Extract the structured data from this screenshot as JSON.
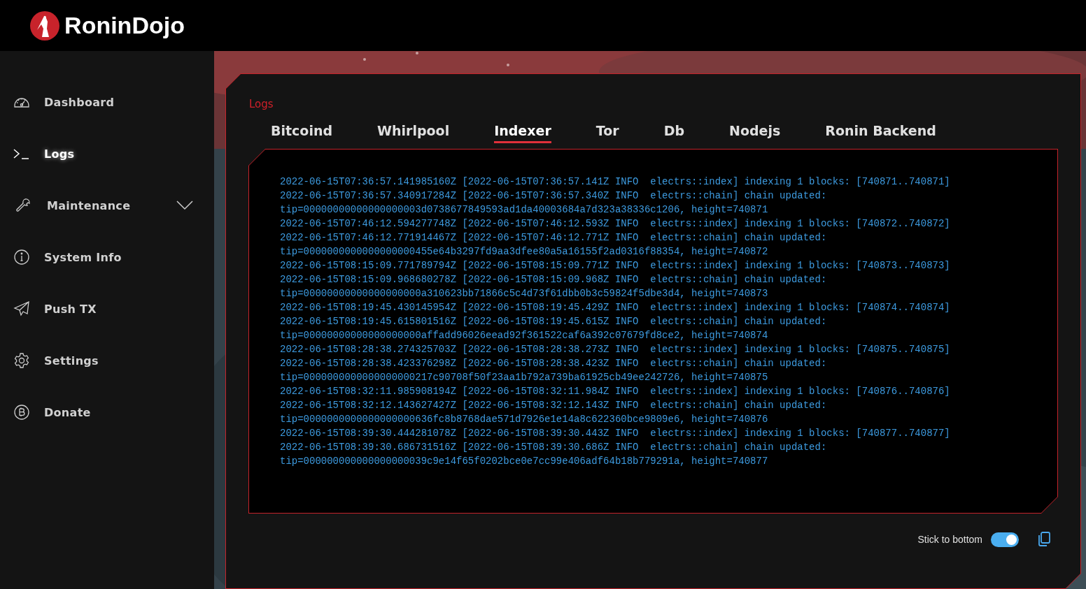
{
  "brand": "RoninDojo",
  "nav": [
    {
      "label": "Dashboard",
      "kind": "gauge",
      "selected": false
    },
    {
      "label": "Logs",
      "kind": "terminal",
      "selected": true
    },
    {
      "label": "Maintenance",
      "kind": "wrench",
      "selected": false,
      "expanded": false
    },
    {
      "label": "System Info",
      "kind": "info",
      "selected": false
    },
    {
      "label": "Push TX",
      "kind": "plane",
      "selected": false
    },
    {
      "label": "Settings",
      "kind": "gear",
      "selected": false
    },
    {
      "label": "Donate",
      "kind": "bitcoin",
      "selected": false
    }
  ],
  "page": {
    "title": "Logs",
    "tabs": [
      {
        "label": "Bitcoind",
        "selected": false
      },
      {
        "label": "Whirlpool",
        "selected": false
      },
      {
        "label": "Indexer",
        "selected": true
      },
      {
        "label": "Tor",
        "selected": false
      },
      {
        "label": "Db",
        "selected": false
      },
      {
        "label": "Nodejs",
        "selected": false
      },
      {
        "label": "Ronin Backend",
        "selected": false
      }
    ],
    "log_lines": [
      "2022-06-15T07:36:57.141985160Z [2022-06-15T07:36:57.141Z INFO  electrs::index] indexing 1 blocks: [740871..740871]",
      "2022-06-15T07:36:57.340917284Z [2022-06-15T07:36:57.340Z INFO  electrs::chain] chain updated:",
      "tip=00000000000000000003d0738677849593ad1da40003684a7d323a38336c1206, height=740871",
      "2022-06-15T07:46:12.594277748Z [2022-06-15T07:46:12.593Z INFO  electrs::index] indexing 1 blocks: [740872..740872]",
      "2022-06-15T07:46:12.771914467Z [2022-06-15T07:46:12.771Z INFO  electrs::chain] chain updated:",
      "tip=0000000000000000000455e64b3297fd9aa3dfee80a5a16155f2ad0316f88354, height=740872",
      "2022-06-15T08:15:09.771789794Z [2022-06-15T08:15:09.771Z INFO  electrs::index] indexing 1 blocks: [740873..740873]",
      "2022-06-15T08:15:09.968680278Z [2022-06-15T08:15:09.968Z INFO  electrs::chain] chain updated:",
      "tip=00000000000000000000a310623bb71866c5c4d73f61dbb0b3c59824f5dbe3d4, height=740873",
      "2022-06-15T08:19:45.430145954Z [2022-06-15T08:19:45.429Z INFO  electrs::index] indexing 1 blocks: [740874..740874]",
      "2022-06-15T08:19:45.615801516Z [2022-06-15T08:19:45.615Z INFO  electrs::chain] chain updated:",
      "tip=00000000000000000000affadd96026eead92f361522caf6a392c07679fd8ce2, height=740874",
      "2022-06-15T08:28:38.274325703Z [2022-06-15T08:28:38.273Z INFO  electrs::index] indexing 1 blocks: [740875..740875]",
      "2022-06-15T08:28:38.423376298Z [2022-06-15T08:28:38.423Z INFO  electrs::chain] chain updated:",
      "tip=0000000000000000000217c90708f50f23aa1b792a739ba61925cb49ee242726, height=740875",
      "2022-06-15T08:32:11.985908194Z [2022-06-15T08:32:11.984Z INFO  electrs::index] indexing 1 blocks: [740876..740876]",
      "2022-06-15T08:32:12.143627427Z [2022-06-15T08:32:12.143Z INFO  electrs::chain] chain updated:",
      "tip=0000000000000000000636fc8b8768dae571d7926e1e14a8c622360bce9809e6, height=740876",
      "2022-06-15T08:39:30.444281078Z [2022-06-15T08:39:30.443Z INFO  electrs::index] indexing 1 blocks: [740877..740877]",
      "2022-06-15T08:39:30.686731516Z [2022-06-15T08:39:30.686Z INFO  electrs::chain] chain updated:",
      "tip=000000000000000000039c9e14f65f0202bce0e7cc99e406adf64b18b779291a, height=740877"
    ],
    "stick_to_bottom": {
      "label": "Stick to bottom",
      "on": true
    }
  }
}
